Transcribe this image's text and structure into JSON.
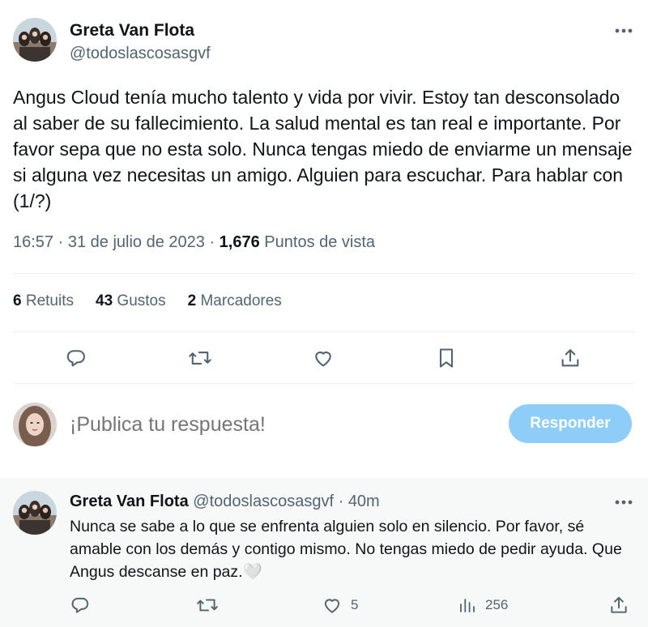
{
  "main_tweet": {
    "author_name": "Greta Van Flota",
    "author_handle": "@todoslascosasgvf",
    "text": "Angus Cloud tenía mucho talento y vida por vivir. Estoy tan desconsolado al saber de su fallecimiento. La salud mental es tan real e importante. Por favor sepa que no esta solo. Nunca tengas miedo de enviarme un mensaje si alguna vez necesitas un amigo. Alguien para escuchar. Para hablar con (1/?)",
    "time": "16:57",
    "date": "31 de julio de 2023",
    "views_count": "1,676",
    "views_label": "Puntos de vista",
    "stats": {
      "retweets_count": "6",
      "retweets_label": "Retuits",
      "likes_count": "43",
      "likes_label": "Gustos",
      "bookmarks_count": "2",
      "bookmarks_label": "Marcadores"
    },
    "actions": [
      "reply-icon",
      "retweet-icon",
      "like-icon",
      "bookmark-icon",
      "share-icon"
    ]
  },
  "composer": {
    "placeholder": "¡Publica tu respuesta!",
    "button_label": "Responder"
  },
  "reply_tweet": {
    "author_name": "Greta Van Flota",
    "author_handle": "@todoslascosasgvf",
    "separator": "·",
    "time_ago": "40m",
    "text": "Nunca se sabe a lo que se enfrenta alguien solo en silencio. Por favor, sé amable con los demás y contigo mismo. No tengas miedo de pedir ayuda. Que Angus descanse en paz.🤍",
    "likes": "5",
    "views": "256"
  },
  "colors": {
    "text_primary": "#0f1419",
    "text_secondary": "#536471",
    "button_disabled": "#8ecdf8",
    "reply_background": "#f7f9f9",
    "divider": "#eff3f4"
  }
}
